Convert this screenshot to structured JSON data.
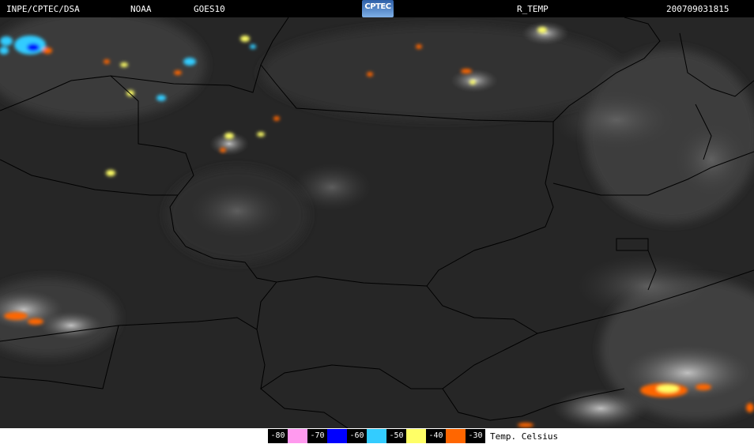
{
  "header": {
    "source": "INPE/CPTEC/DSA",
    "agency": "NOAA",
    "satellite": "GOES10",
    "logo_text": "CPTEC",
    "product": "R_TEMP",
    "timestamp": "200709031815"
  },
  "legend": {
    "unit_label": "Temp. Celsius",
    "scale": [
      {
        "label": "-80",
        "color": "#ff99ee"
      },
      {
        "label": "-70",
        "color": "#0000ff"
      },
      {
        "label": "-60",
        "color": "#33ccff"
      },
      {
        "label": "-50",
        "color": "#ffff66"
      },
      {
        "label": "-40",
        "color": "#ff6600"
      },
      {
        "label": "-30",
        "color": ""
      }
    ]
  },
  "colors": {
    "background": "#000000",
    "land_dark": "#262626",
    "cloud_gray": "#8a8a8a",
    "border_line": "#000000"
  }
}
